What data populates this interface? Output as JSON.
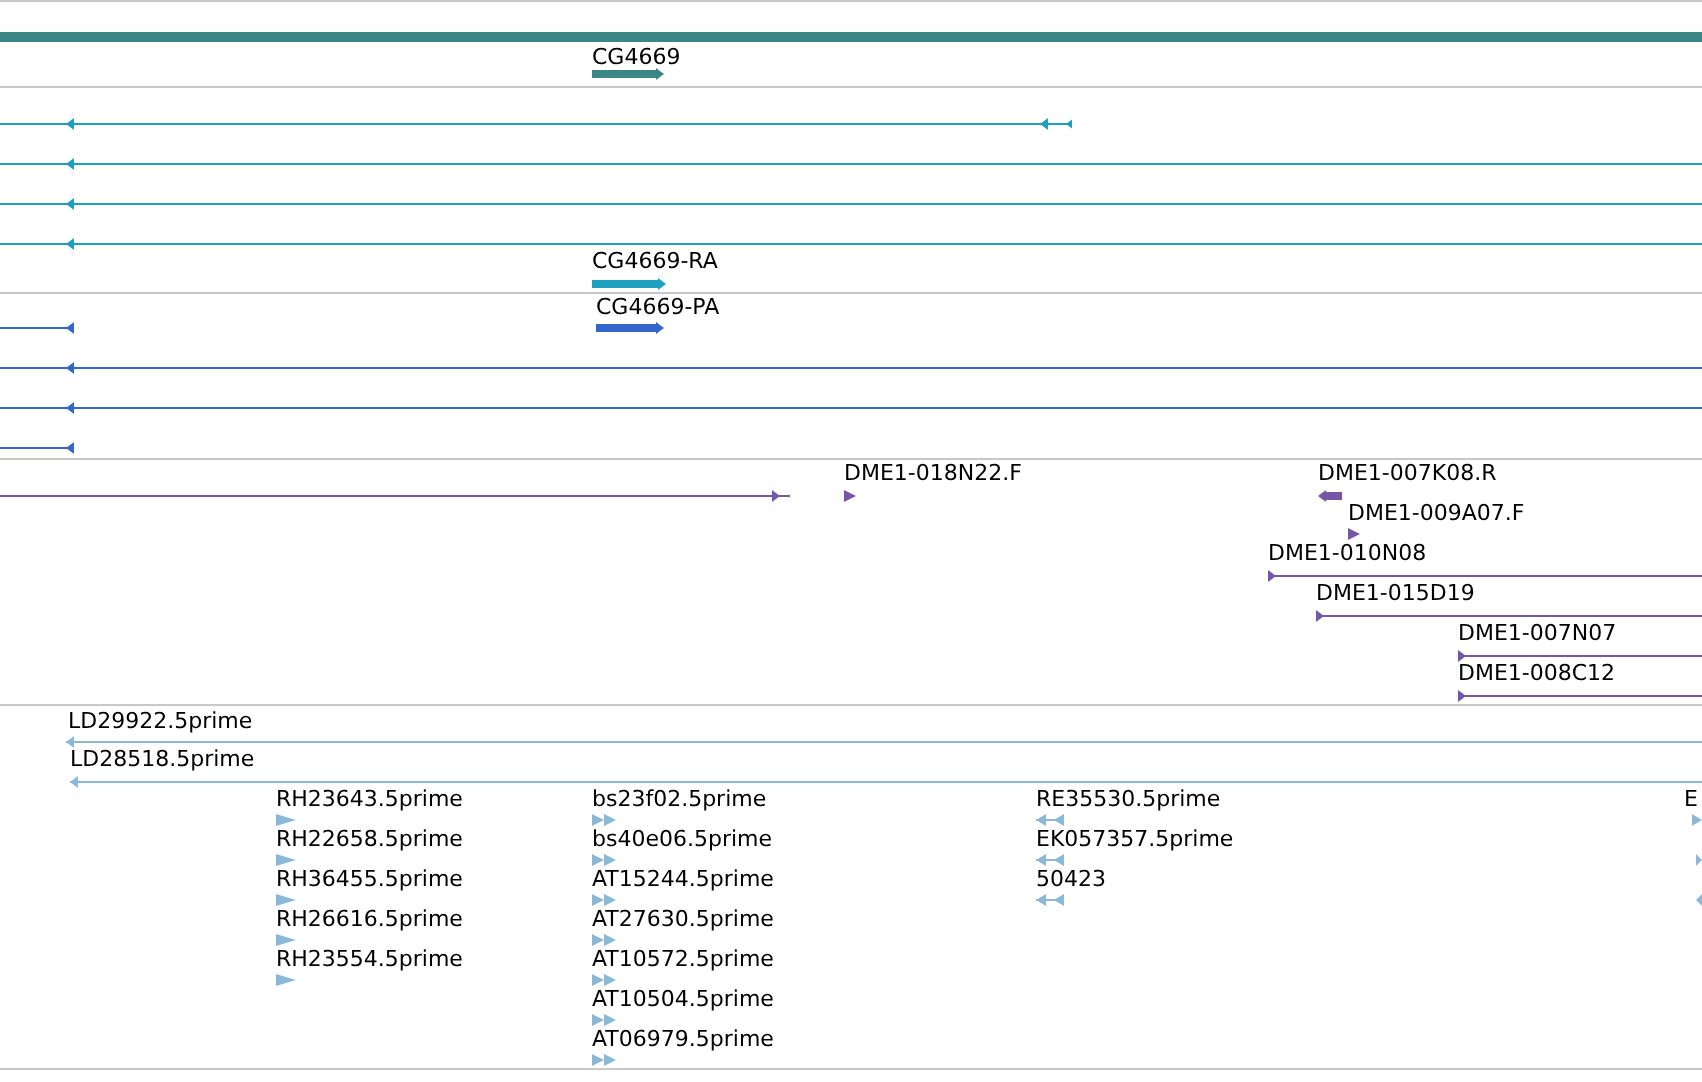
{
  "tracks": [
    {
      "color": "#3b8686",
      "features": [
        {
          "label": "CG4669",
          "reverse": false
        }
      ]
    },
    {
      "color": "#1d9fc0",
      "features": [
        {
          "reverse": true
        },
        {
          "reverse": true
        },
        {
          "reverse": true
        },
        {
          "reverse": true
        },
        {
          "label": "CG4669-RA",
          "reverse": false
        }
      ]
    },
    {
      "color": "#3366cc",
      "features": [
        {
          "label": "CG4669-PA",
          "reverse": false
        },
        {
          "reverse": true
        },
        {
          "reverse": true
        },
        {
          "reverse": true
        },
        {
          "reverse": true
        }
      ]
    },
    {
      "color": "#7755aa",
      "features": [
        {
          "reverse": false
        },
        {
          "label": "DME1-018N22.F",
          "reverse": false
        },
        {
          "label": "DME1-007K08.R",
          "reverse": true
        },
        {
          "label": "DME1-009A07.F",
          "reverse": false
        },
        {
          "label": "DME1-010N08",
          "reverse": false
        },
        {
          "label": "DME1-015D19",
          "reverse": false
        },
        {
          "label": "DME1-007N07",
          "reverse": false
        },
        {
          "label": "DME1-008C12",
          "reverse": false
        }
      ]
    },
    {
      "color": "#8bb8d8",
      "features": [
        {
          "label": "LD29922.5prime",
          "reverse": true
        },
        {
          "label": "LD28518.5prime",
          "reverse": true
        },
        {
          "label": "RH23643.5prime",
          "reverse": false
        },
        {
          "label": "RH22658.5prime",
          "reverse": false
        },
        {
          "label": "RH36455.5prime",
          "reverse": false
        },
        {
          "label": "RH26616.5prime",
          "reverse": false
        },
        {
          "label": "RH23554.5prime",
          "reverse": false
        },
        {
          "label": "bs23f02.5prime",
          "reverse": false
        },
        {
          "label": "bs40e06.5prime",
          "reverse": false
        },
        {
          "label": "AT15244.5prime",
          "reverse": false
        },
        {
          "label": "AT27630.5prime",
          "reverse": false
        },
        {
          "label": "AT10572.5prime",
          "reverse": false
        },
        {
          "label": "AT10504.5prime",
          "reverse": false
        },
        {
          "label": "AT06979.5prime",
          "reverse": false
        },
        {
          "label": "RE35530.5prime",
          "reverse": true
        },
        {
          "label": "EK057357.5prime",
          "reverse": true
        },
        {
          "label": "50423",
          "reverse": true
        },
        {
          "label": "E",
          "reverse": false
        },
        {
          "reverse": false
        },
        {
          "reverse": true
        }
      ]
    }
  ]
}
